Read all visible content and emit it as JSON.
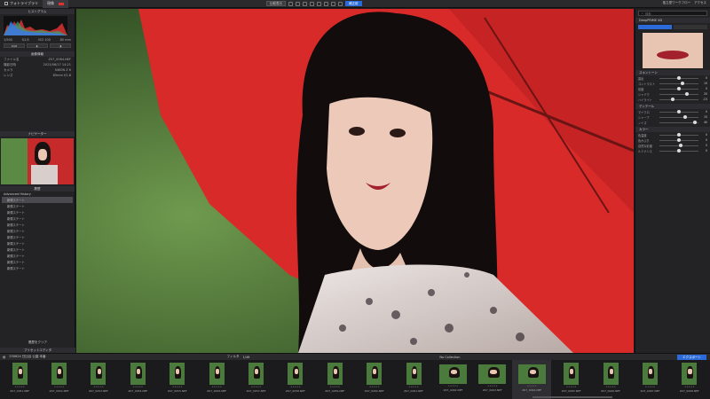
{
  "topbar": {
    "tab1": "フォトライブラリ",
    "tab2": "現像",
    "btn_compare": "比較表示",
    "btn_before": "補正前",
    "right_a": "独立型ワークフロー",
    "right_b": "アクセス"
  },
  "left": {
    "histogram_title": "ヒストグラム",
    "rgb_label": "RGB",
    "exif_a": "1/500",
    "exif_b": "f/2.8",
    "exif_c": "ISO 100",
    "exif_d": "85 mm",
    "info_title": "画像情報",
    "info_rows": [
      {
        "k": "ファイル名",
        "v": "Z07_0064.NEF"
      },
      {
        "k": "撮影日時",
        "v": "2023/06/17 14:21"
      },
      {
        "k": "カメラ",
        "v": "NIKON Z 6"
      },
      {
        "k": "レンズ",
        "v": "85mm f/1.8"
      }
    ],
    "navigator_title": "ナビゲーター",
    "history_title": "履歴",
    "history_head": "Advanced History",
    "history_items": [
      "新規ステート",
      "新規ステート",
      "新規ステート",
      "新規ステート",
      "新規ステート",
      "新規ステート",
      "新規ステート",
      "新規ステート",
      "新規ステート",
      "新規ステート",
      "新規ステート",
      "新規ステート"
    ],
    "bottom_btn": "履歴をクリア",
    "footer": "プリセットエディタ"
  },
  "right": {
    "search_placeholder": "検索",
    "sect1": "DeepPRIME XD",
    "sect_skin": "スキントーン",
    "sect_detail": "ディテール",
    "sect_color": "カラー",
    "sliders1": [
      {
        "label": "露出",
        "value": "0"
      },
      {
        "label": "コントラスト",
        "value": "10"
      },
      {
        "label": "彩度",
        "value": "0"
      },
      {
        "label": "シャドウ",
        "value": "20"
      },
      {
        "label": "ハイライト",
        "value": "-15"
      }
    ],
    "sliders2": [
      {
        "label": "マイクロ",
        "value": "0"
      },
      {
        "label": "シャープ",
        "value": "15"
      },
      {
        "label": "ノイズ",
        "value": "40"
      }
    ],
    "sliders3": [
      {
        "label": "色温度",
        "value": "0"
      },
      {
        "label": "色かぶり",
        "value": "0"
      },
      {
        "label": "自然な彩度",
        "value": "5"
      },
      {
        "label": "ルミナンス",
        "value": "0"
      }
    ]
  },
  "filmstrip": {
    "path": "230624 日比谷 公園 本番",
    "count": "1/46",
    "filter_label": "フィルタ",
    "collection": "No Collection",
    "export": "エクスポート",
    "items": [
      {
        "name": "Z07_0051.NEF",
        "wide": false
      },
      {
        "name": "Z07_0052.NEF",
        "wide": false
      },
      {
        "name": "Z07_0053.NEF",
        "wide": false
      },
      {
        "name": "Z07_0054.NEF",
        "wide": false
      },
      {
        "name": "Z07_0055.NEF",
        "wide": false
      },
      {
        "name": "Z07_0056.NEF",
        "wide": false
      },
      {
        "name": "Z07_0057.NEF",
        "wide": false
      },
      {
        "name": "Z07_0058.NEF",
        "wide": false
      },
      {
        "name": "Z07_0059.NEF",
        "wide": false
      },
      {
        "name": "Z07_0060.NEF",
        "wide": false
      },
      {
        "name": "Z07_0061.NEF",
        "wide": false
      },
      {
        "name": "Z07_0062.NEF",
        "wide": true
      },
      {
        "name": "Z07_0063.NEF",
        "wide": true
      },
      {
        "name": "Z07_0064.NEF",
        "wide": true
      },
      {
        "name": "Z07_0065.NEF",
        "wide": false
      },
      {
        "name": "Z07_0066.NEF",
        "wide": false
      },
      {
        "name": "Z07_0067.NEF",
        "wide": false
      },
      {
        "name": "Z07_0068.NEF",
        "wide": false
      }
    ]
  },
  "colors": {
    "accent": "#2b6ad8",
    "umbrella": "#d62a2a",
    "foliage": "#4f7a3a"
  }
}
